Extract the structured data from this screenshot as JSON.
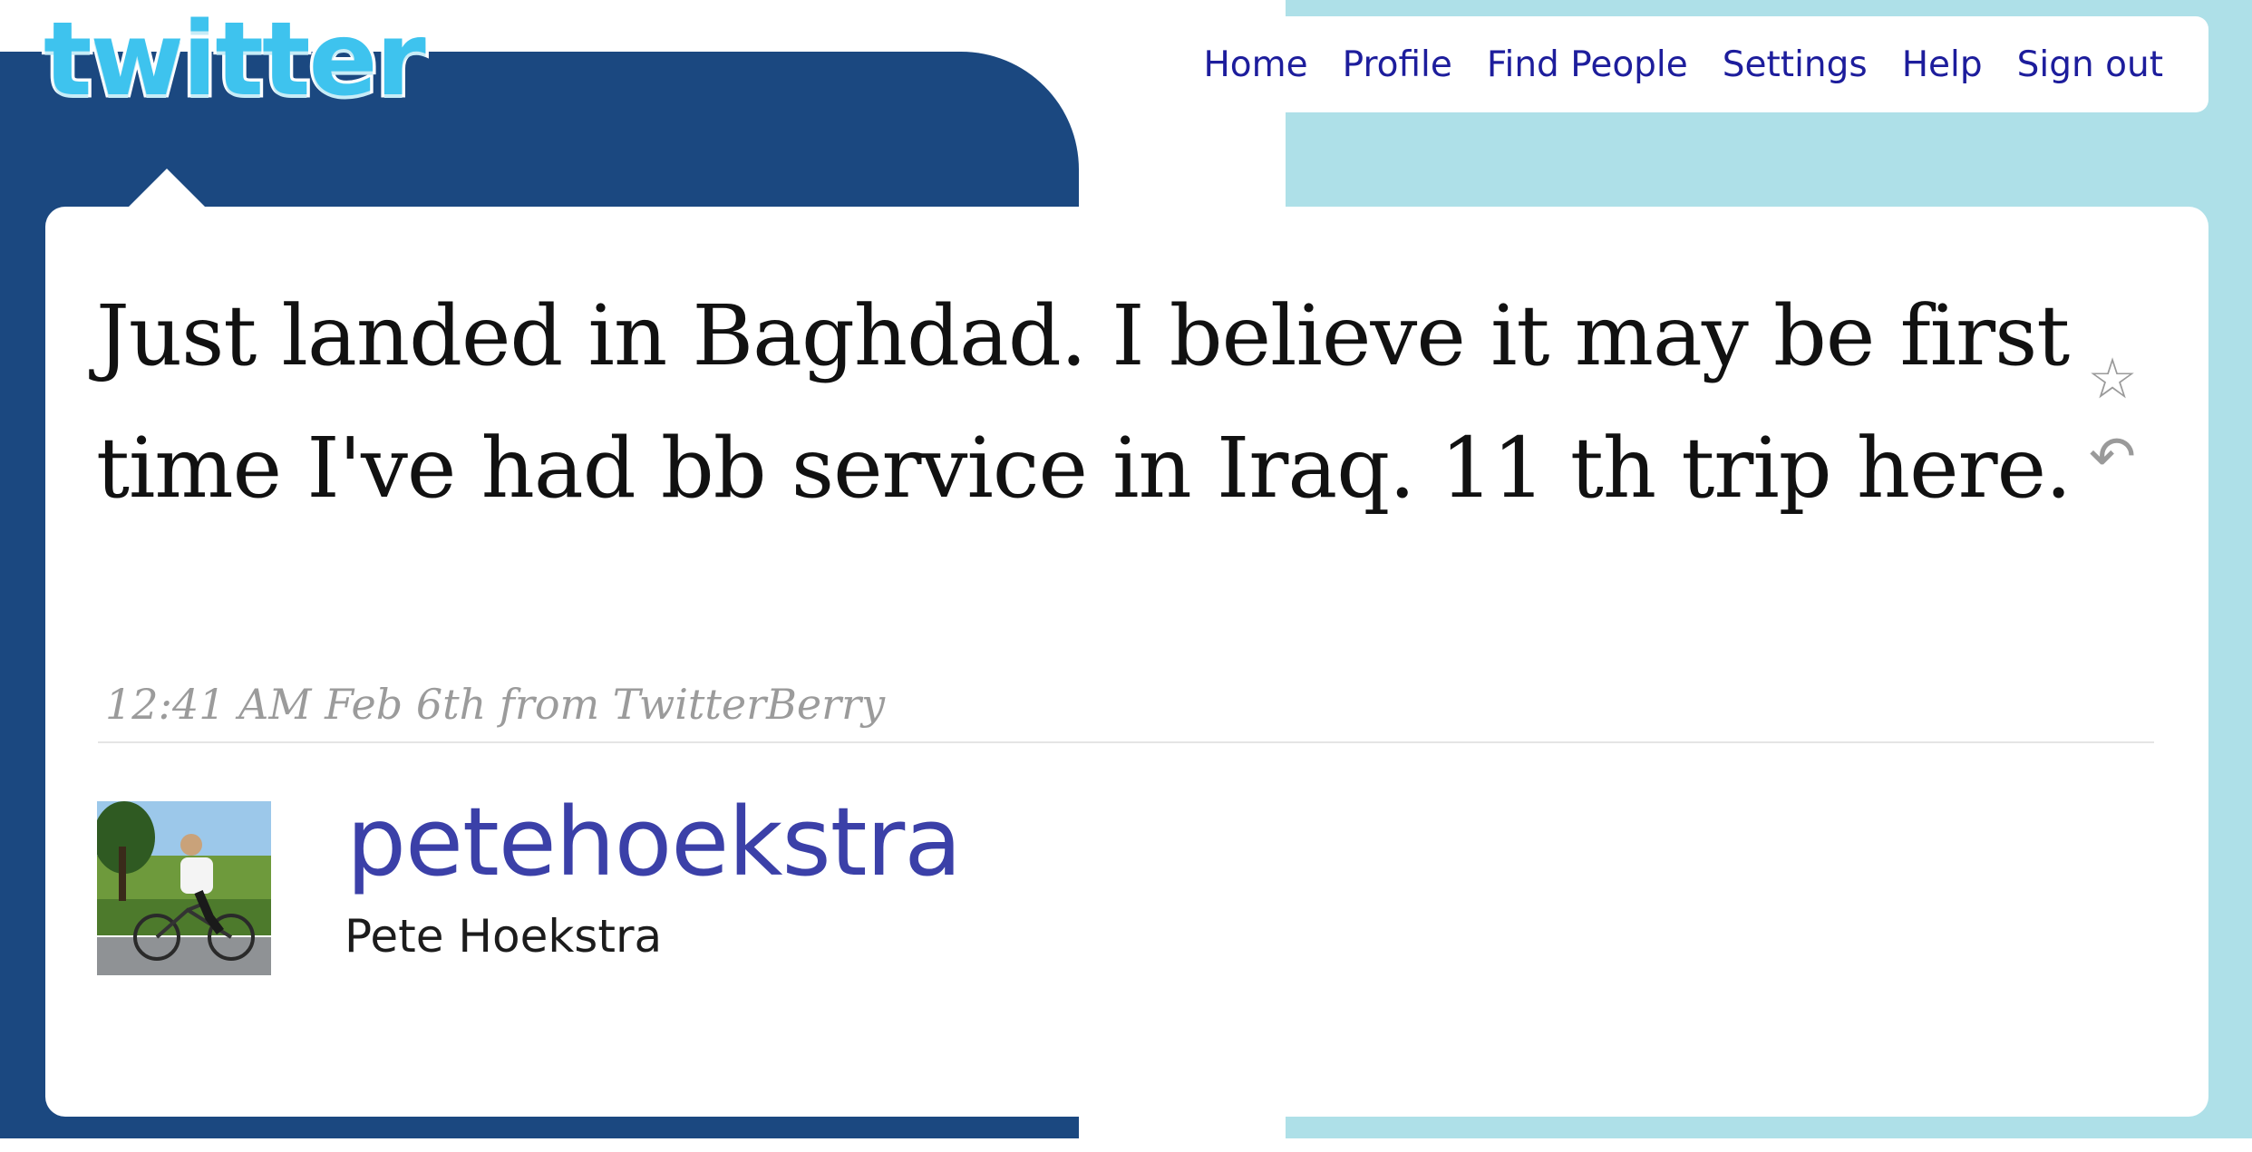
{
  "header": {
    "logo_text": "twitter",
    "nav": [
      {
        "label": "Home"
      },
      {
        "label": "Profile"
      },
      {
        "label": "Find People"
      },
      {
        "label": "Settings"
      },
      {
        "label": "Help"
      },
      {
        "label": "Sign out"
      }
    ]
  },
  "tweet": {
    "text": "Just landed in Baghdad. I believe it may be first time I've had bb service in Iraq. 11 th trip here.",
    "timestamp": "12:41 AM Feb 6th",
    "from_label": "from",
    "source": "TwitterBerry",
    "actions": [
      {
        "name": "favorite-star-icon",
        "glyph": "☆"
      },
      {
        "name": "reply-arrow-icon",
        "glyph": "↶"
      }
    ]
  },
  "author": {
    "screen_name": "petehoekstra",
    "full_name": "Pete Hoekstra"
  },
  "colors": {
    "dark_background": "#1b4880",
    "light_background": "#aee0e8",
    "logo_blue": "#3ec3ee",
    "nav_link": "#1d1d9c",
    "screen_name": "#3b40a8",
    "meta_gray": "#9b9b9b"
  }
}
